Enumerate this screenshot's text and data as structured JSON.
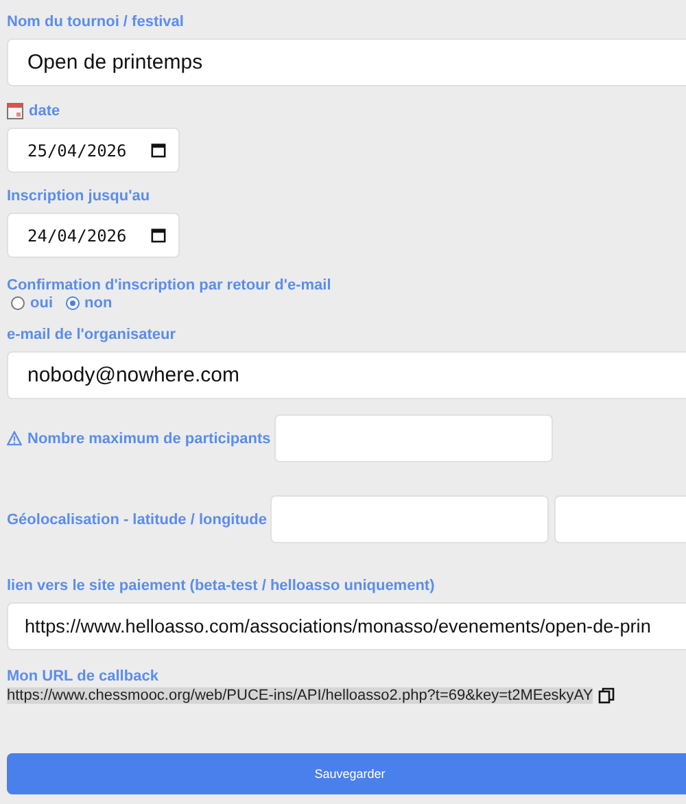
{
  "fields": [
    {
      "kind": "text",
      "label": "Nom du tournoi / festival",
      "value": "Open de printemps"
    },
    {
      "kind": "caldate",
      "label": "date",
      "value": "25/04/2026"
    },
    {
      "kind": "date",
      "label": "Inscription jusqu'au",
      "value": "24/04/2026"
    },
    {
      "kind": "radio",
      "label": "Confirmation d'inscription par retour d'e-mail",
      "options": [
        {
          "label": "oui",
          "selected": false
        },
        {
          "label": "non",
          "selected": true
        }
      ]
    },
    {
      "kind": "text",
      "label": "e-mail de l'organisateur",
      "value": "nobody@nowhere.com"
    },
    {
      "kind": "alert",
      "label": "Nombre maximum de participants"
    },
    {
      "kind": "pair",
      "label": "Géolocalisation - latitude / longitude"
    },
    {
      "kind": "text",
      "label": "lien vers le site paiement (beta-test / helloasso uniquement)",
      "value": "https://www.helloasso.com/associations/monasso/evenements/open-de-prin"
    },
    {
      "kind": "readonly",
      "label": "Mon URL de callback",
      "value": "https://www.chessmooc.org/web/PUCE-ins/API/helloasso2.php?t=69&key=t2MEeskyAY"
    }
  ],
  "button": "Sauvegarder"
}
